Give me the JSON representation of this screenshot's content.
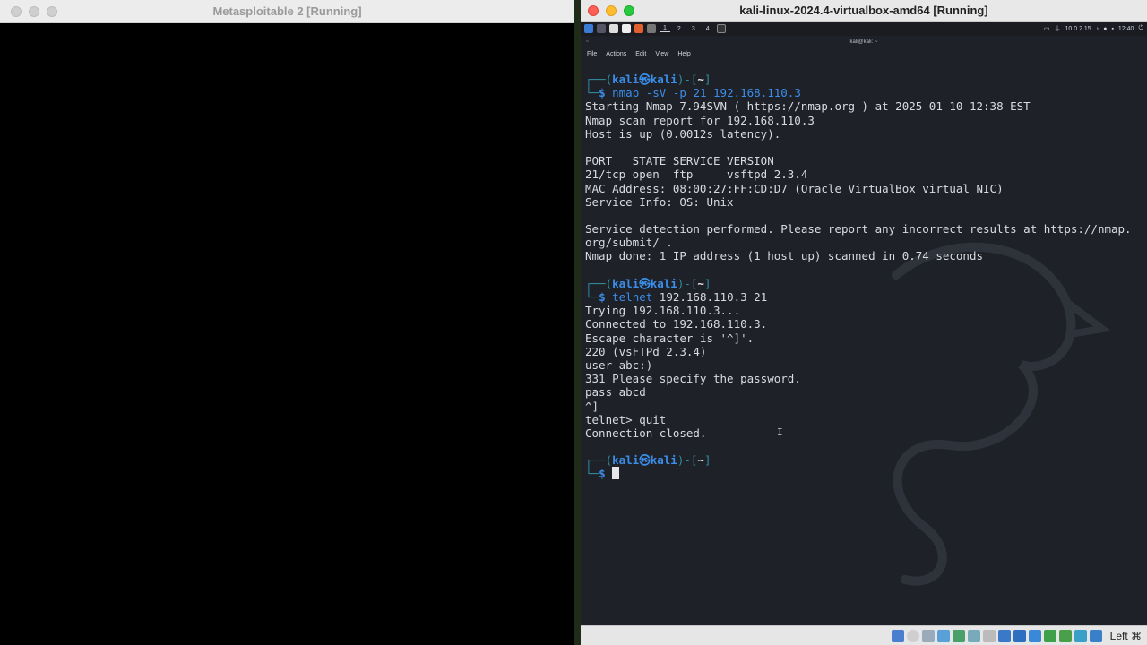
{
  "left_window": {
    "title": "Metasploitable 2 [Running]"
  },
  "right_window": {
    "title": "kali-linux-2024.4-virtualbox-amd64 [Running]"
  },
  "kali_panel": {
    "workspaces": [
      "1",
      "2",
      "3",
      "4"
    ],
    "ip": "10.0.2.15",
    "clock": "12:40"
  },
  "terminal": {
    "window_title": "kali@kali: ~",
    "menu": [
      "File",
      "Actions",
      "Edit",
      "View",
      "Help"
    ],
    "prompt_user": "kali",
    "prompt_host": "kali",
    "prompt_dir": "~",
    "lines": [
      {
        "type": "prompt1"
      },
      {
        "type": "prompt2",
        "cmd": "nmap",
        "args": " -sV -p 21 192.168.110.3",
        "args_style": "mixed"
      },
      {
        "type": "out",
        "text": "Starting Nmap 7.94SVN ( https://nmap.org ) at 2025-01-10 12:38 EST"
      },
      {
        "type": "out",
        "text": "Nmap scan report for 192.168.110.3"
      },
      {
        "type": "out",
        "text": "Host is up (0.0012s latency)."
      },
      {
        "type": "out",
        "text": ""
      },
      {
        "type": "out",
        "text": "PORT   STATE SERVICE VERSION"
      },
      {
        "type": "out",
        "text": "21/tcp open  ftp     vsftpd 2.3.4"
      },
      {
        "type": "out",
        "text": "MAC Address: 08:00:27:FF:CD:D7 (Oracle VirtualBox virtual NIC)"
      },
      {
        "type": "out",
        "text": "Service Info: OS: Unix"
      },
      {
        "type": "out",
        "text": ""
      },
      {
        "type": "out",
        "text": "Service detection performed. Please report any incorrect results at https://nmap."
      },
      {
        "type": "out",
        "text": "org/submit/ ."
      },
      {
        "type": "out",
        "text": "Nmap done: 1 IP address (1 host up) scanned in 0.74 seconds"
      },
      {
        "type": "out",
        "text": ""
      },
      {
        "type": "prompt1"
      },
      {
        "type": "prompt2",
        "cmd": "telnet",
        "args": " 192.168.110.3 21"
      },
      {
        "type": "out",
        "text": "Trying 192.168.110.3..."
      },
      {
        "type": "out",
        "text": "Connected to 192.168.110.3."
      },
      {
        "type": "out",
        "text": "Escape character is '^]'."
      },
      {
        "type": "out",
        "text": "220 (vsFTPd 2.3.4)"
      },
      {
        "type": "out",
        "text": "user abc:)"
      },
      {
        "type": "out",
        "text": "331 Please specify the password."
      },
      {
        "type": "out",
        "text": "pass abcd"
      },
      {
        "type": "out",
        "text": "^]"
      },
      {
        "type": "out",
        "text": "telnet> quit"
      },
      {
        "type": "out",
        "text": "Connection closed."
      },
      {
        "type": "out",
        "text": ""
      },
      {
        "type": "prompt1"
      },
      {
        "type": "prompt2",
        "cmd": "",
        "args": "",
        "cursor": true
      }
    ]
  },
  "statusbar": {
    "host_key": "Left ⌘"
  },
  "colors": {
    "prompt_frame": "#2f8ea0",
    "prompt_user": "#3b8eea",
    "terminal_bg": "#1e2128"
  }
}
